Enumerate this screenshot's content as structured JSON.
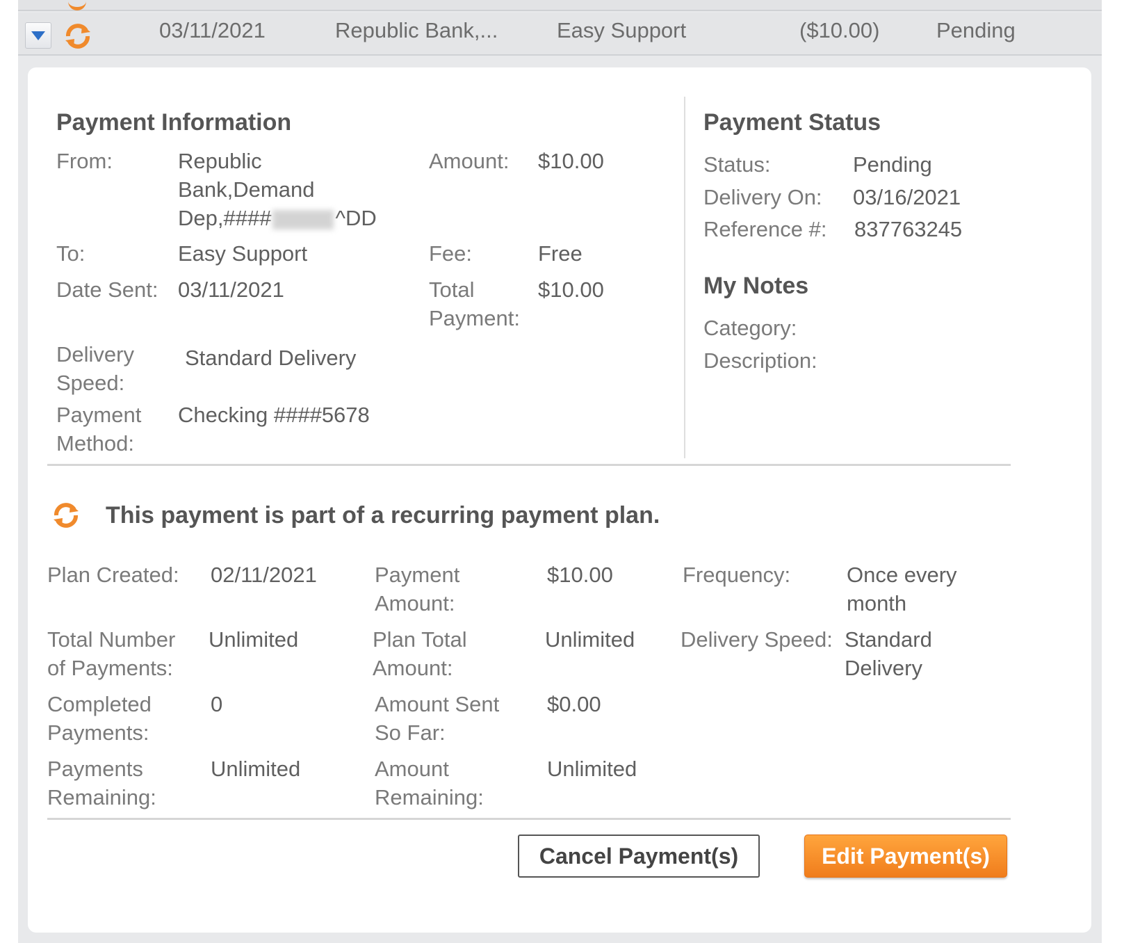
{
  "colors": {
    "accent": "#f08a2c",
    "expander_arrow": "#2d6fc7"
  },
  "row": {
    "date": "03/11/2021",
    "from": "Republic Bank,...",
    "payee": "Easy Support",
    "amount": "($10.00)",
    "status": "Pending"
  },
  "payment_information": {
    "heading": "Payment Information",
    "from_label": "From:",
    "from_value_line1": "Republic",
    "from_value_line2": "Bank,Demand",
    "from_value_line3_prefix": "Dep,####",
    "from_value_line3_suffix": "^DD",
    "to_label": "To:",
    "to_value": "Easy Support",
    "date_sent_label": "Date Sent:",
    "date_sent_value": "03/11/2021",
    "delivery_speed_label_1": "Delivery",
    "delivery_speed_label_2": "Speed:",
    "delivery_speed_value": "Standard Delivery",
    "payment_method_label_1": "Payment",
    "payment_method_label_2": "Method:",
    "payment_method_value": "Checking ####5678",
    "amount_label": "Amount:",
    "amount_value": "$10.00",
    "fee_label": "Fee:",
    "fee_value": "Free",
    "total_payment_label_1": "Total",
    "total_payment_label_2": "Payment:",
    "total_payment_value": "$10.00"
  },
  "payment_status": {
    "heading": "Payment Status",
    "status_label": "Status:",
    "status_value": "Pending",
    "delivery_on_label": "Delivery On:",
    "delivery_on_value": "03/16/2021",
    "reference_label": "Reference #:",
    "reference_value": "837763245"
  },
  "my_notes": {
    "heading": "My Notes",
    "category_label": "Category:",
    "description_label": "Description:"
  },
  "recurring": {
    "message": "This payment is part of a recurring payment plan.",
    "plan_created_label": "Plan Created:",
    "plan_created_value": "02/11/2021",
    "total_number_label_1": "Total Number",
    "total_number_label_2": "of Payments:",
    "total_number_value": "Unlimited",
    "completed_label_1": "Completed",
    "completed_label_2": "Payments:",
    "completed_value": "0",
    "remaining_label_1": "Payments",
    "remaining_label_2": "Remaining:",
    "remaining_value": "Unlimited",
    "payment_amount_label_1": "Payment",
    "payment_amount_label_2": "Amount:",
    "payment_amount_value": "$10.00",
    "plan_total_label_1": "Plan Total",
    "plan_total_label_2": "Amount:",
    "plan_total_value": "Unlimited",
    "amount_sent_label_1": "Amount Sent",
    "amount_sent_label_2": "So Far:",
    "amount_sent_value": "$0.00",
    "amount_remaining_label_1": "Amount",
    "amount_remaining_label_2": "Remaining:",
    "amount_remaining_value": "Unlimited",
    "frequency_label": "Frequency:",
    "frequency_value_1": "Once every",
    "frequency_value_2": "month",
    "delivery_speed_label": "Delivery Speed:",
    "delivery_speed_value_1": "Standard",
    "delivery_speed_value_2": "Delivery"
  },
  "buttons": {
    "cancel": "Cancel Payment(s)",
    "edit": "Edit Payment(s)"
  }
}
